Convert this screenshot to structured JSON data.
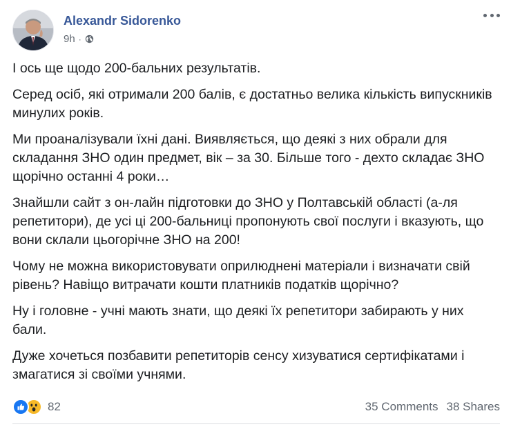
{
  "post": {
    "author": "Alexandr Sidorenko",
    "time": "9h",
    "separator": "·",
    "privacy_icon": "globe-icon",
    "paragraphs": [
      "І ось ще щодо 200-бальних результатів.",
      "Серед осіб, які отримали 200 балів, є достатньо велика кількість випускників минулих років.",
      "Ми проаналізували їхні дані. Виявляється, що деякі з них обрали для складання ЗНО один предмет, вік – за 30. Більше того - дехто складає ЗНО щорічно останні 4 роки…",
      "Знайшли сайт з он-лайн підготовки до ЗНО у Полтавській області (а-ля репетитори), де усі ці 200-бальниці пропонують свої послуги і вказують, що вони склали цьогорічне ЗНО на 200!",
      "Чому не можна використовувати оприлюднені матеріали і визначати свій рівень? Навіщо витрачати кошти платників податків щорічно?",
      "Ну і головне - учні мають знати, що деякі їх репетитори забирають у них бали.",
      "Дуже хочеться позбавити репетиторів сенсу хизуватися сертифікатами і змагатися зі своїми учнями."
    ]
  },
  "footer": {
    "reactions": [
      "like-icon",
      "wow-icon"
    ],
    "reaction_count": "82",
    "comments": "35 Comments",
    "shares": "38 Shares"
  },
  "colors": {
    "author": "#385898",
    "meta": "#606770",
    "like": "#1877f2",
    "wow": "#f7b928"
  }
}
